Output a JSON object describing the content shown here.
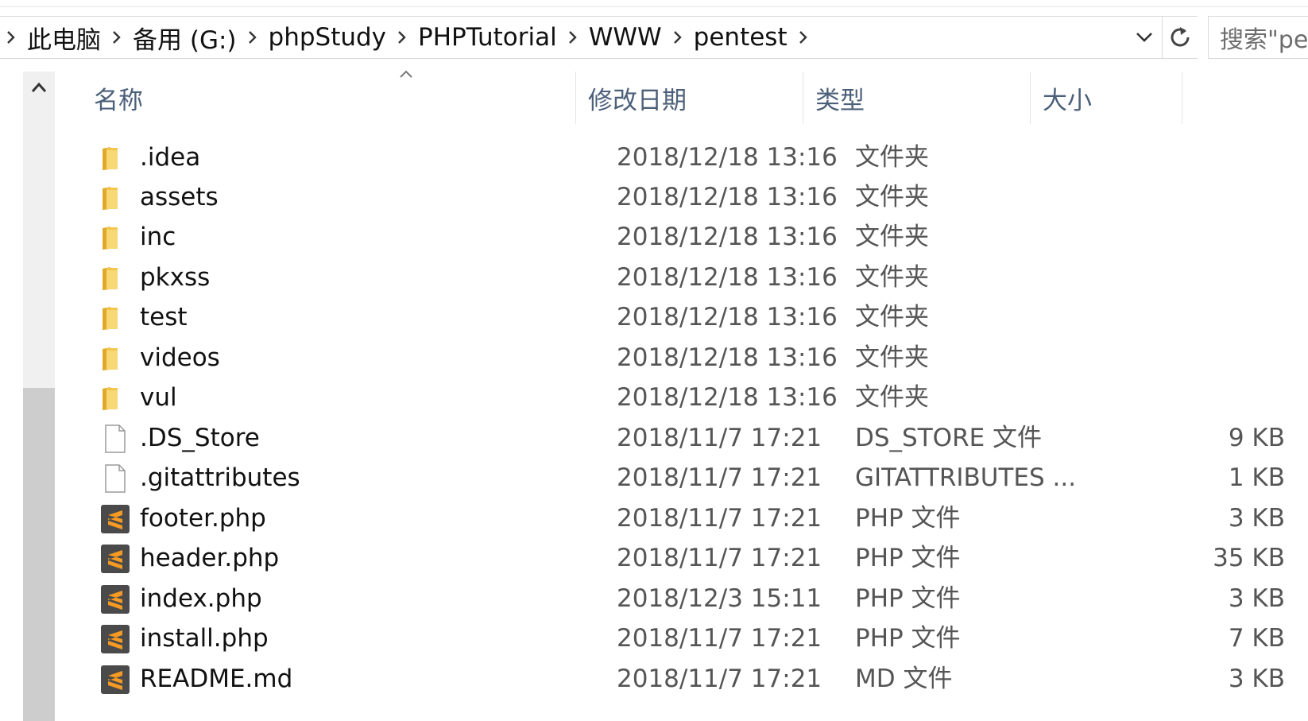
{
  "breadcrumb": {
    "items": [
      "此电脑",
      "备用 (G:)",
      "phpStudy",
      "PHPTutorial",
      "WWW",
      "pentest"
    ]
  },
  "search": {
    "placeholder": "搜索\"pe"
  },
  "columns": {
    "name": "名称",
    "date": "修改日期",
    "type": "类型",
    "size": "大小"
  },
  "files": [
    {
      "name": ".idea",
      "date": "2018/12/18 13:16",
      "type": "文件夹",
      "size": "",
      "icon": "folder-icon"
    },
    {
      "name": "assets",
      "date": "2018/12/18 13:16",
      "type": "文件夹",
      "size": "",
      "icon": "folder-icon"
    },
    {
      "name": "inc",
      "date": "2018/12/18 13:16",
      "type": "文件夹",
      "size": "",
      "icon": "folder-icon"
    },
    {
      "name": "pkxss",
      "date": "2018/12/18 13:16",
      "type": "文件夹",
      "size": "",
      "icon": "folder-icon"
    },
    {
      "name": "test",
      "date": "2018/12/18 13:16",
      "type": "文件夹",
      "size": "",
      "icon": "folder-icon"
    },
    {
      "name": "videos",
      "date": "2018/12/18 13:16",
      "type": "文件夹",
      "size": "",
      "icon": "folder-icon"
    },
    {
      "name": "vul",
      "date": "2018/12/18 13:16",
      "type": "文件夹",
      "size": "",
      "icon": "folder-icon"
    },
    {
      "name": ".DS_Store",
      "date": "2018/11/7 17:21",
      "type": "DS_STORE 文件",
      "size": "9 KB",
      "icon": "blank-file-icon"
    },
    {
      "name": ".gitattributes",
      "date": "2018/11/7 17:21",
      "type": "GITATTRIBUTES ...",
      "size": "1 KB",
      "icon": "blank-file-icon"
    },
    {
      "name": "footer.php",
      "date": "2018/11/7 17:21",
      "type": "PHP 文件",
      "size": "3 KB",
      "icon": "sublime-file-icon"
    },
    {
      "name": "header.php",
      "date": "2018/11/7 17:21",
      "type": "PHP 文件",
      "size": "35 KB",
      "icon": "sublime-file-icon"
    },
    {
      "name": "index.php",
      "date": "2018/12/3 15:11",
      "type": "PHP 文件",
      "size": "3 KB",
      "icon": "sublime-file-icon"
    },
    {
      "name": "install.php",
      "date": "2018/11/7 17:21",
      "type": "PHP 文件",
      "size": "7 KB",
      "icon": "sublime-file-icon"
    },
    {
      "name": "README.md",
      "date": "2018/11/7 17:21",
      "type": "MD 文件",
      "size": "3 KB",
      "icon": "sublime-file-icon"
    }
  ],
  "colors": {
    "folder": "#f3c54b",
    "sublime_bg": "#4a4a4a",
    "sublime_logo": "#f59a23",
    "header_text": "#4c607a"
  }
}
